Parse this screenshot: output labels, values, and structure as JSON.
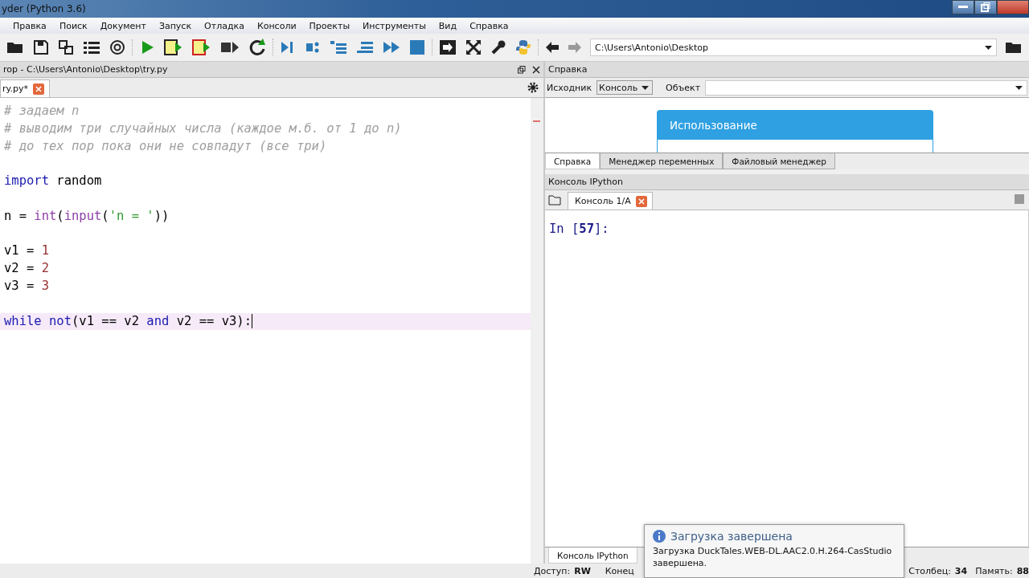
{
  "window": {
    "title": "yder (Python 3.6)"
  },
  "menu": [
    "Правка",
    "Поиск",
    "Документ",
    "Запуск",
    "Отладка",
    "Консоли",
    "Проекты",
    "Инструменты",
    "Вид",
    "Справка"
  ],
  "path_combo": {
    "value": "C:\\Users\\Antonio\\Desktop"
  },
  "editor": {
    "title": "rop - C:\\Users\\Antonio\\Desktop\\try.py",
    "tabs": [
      {
        "label": "ry.py*",
        "selected": true
      }
    ],
    "lines": [
      {
        "current": false,
        "tokens": [
          {
            "kind": "comment",
            "text": "# задаем n"
          }
        ]
      },
      {
        "current": false,
        "tokens": [
          {
            "kind": "comment",
            "text": "# выводим три случайных числа (каждое м.б. от 1 до n)"
          }
        ]
      },
      {
        "current": false,
        "tokens": [
          {
            "kind": "comment",
            "text": "# до тех пор пока они не совпадут (все три)"
          }
        ]
      },
      {
        "current": false
      },
      {
        "current": false,
        "tokens": [
          {
            "kind": "keyword",
            "text": "import"
          },
          {
            "kind": "plain",
            "text": " random"
          }
        ]
      },
      {
        "current": false
      },
      {
        "current": false,
        "tokens": [
          {
            "kind": "plain",
            "text": "n = "
          },
          {
            "kind": "builtin",
            "text": "int"
          },
          {
            "kind": "plain",
            "text": "("
          },
          {
            "kind": "builtin",
            "text": "input"
          },
          {
            "kind": "plain",
            "text": "("
          },
          {
            "kind": "string",
            "text": "'n = '"
          },
          {
            "kind": "plain",
            "text": "))"
          }
        ]
      },
      {
        "current": false
      },
      {
        "current": false,
        "tokens": [
          {
            "kind": "plain",
            "text": "v1 = "
          },
          {
            "kind": "number",
            "text": "1"
          }
        ]
      },
      {
        "current": false,
        "tokens": [
          {
            "kind": "plain",
            "text": "v2 = "
          },
          {
            "kind": "number",
            "text": "2"
          }
        ]
      },
      {
        "current": false,
        "tokens": [
          {
            "kind": "plain",
            "text": "v3 = "
          },
          {
            "kind": "number",
            "text": "3"
          }
        ]
      },
      {
        "current": false
      },
      {
        "current": true,
        "tokens": [
          {
            "kind": "keyword",
            "text": "while"
          },
          {
            "kind": "keyword",
            "text": " not"
          },
          {
            "kind": "plain",
            "text": "(v1 == v2 "
          },
          {
            "kind": "keyword",
            "text": "and"
          },
          {
            "kind": "plain",
            "text": " v2 == v3):"
          }
        ]
      }
    ]
  },
  "help": {
    "title": "Справка",
    "source_label": "Исходник",
    "source_value": "Консоль",
    "object_label": "Объект",
    "card_title": "Использование",
    "tabs": [
      {
        "label": "Справка",
        "selected": true
      },
      {
        "label": "Менеджер переменных",
        "selected": false
      },
      {
        "label": "Файловый менеджер",
        "selected": false
      }
    ]
  },
  "console": {
    "title": "Консоль IPython",
    "tabs": [
      {
        "label": "Консоль 1/A",
        "selected": true
      }
    ],
    "prompt_prefix": "In [",
    "prompt_number": "57",
    "prompt_suffix": "]:",
    "bottom_tabs": [
      {
        "label": "Консоль IPython",
        "selected": true
      }
    ]
  },
  "notification": {
    "title": "Загрузка завершена",
    "message": "Загрузка DuckTales.WEB-DL.AAC2.0.H.264-CasStudio завершена."
  },
  "status_bar": [
    {
      "label": "Доступ:",
      "value": "RW"
    },
    {
      "label": "Конец"
    },
    {
      "label": "Столбец:",
      "value": "34"
    },
    {
      "label": "Память:",
      "value": "88"
    }
  ]
}
